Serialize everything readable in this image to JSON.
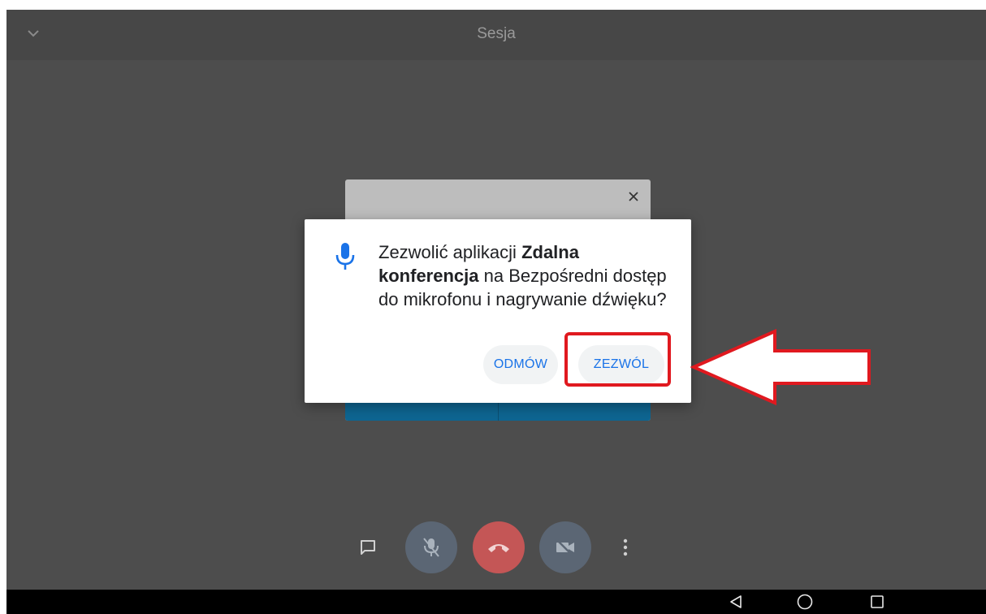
{
  "top_bar": {
    "title": "Sesja",
    "collapse_icon": "chevron-down-icon"
  },
  "background_dialog": {
    "close_icon": "close-icon"
  },
  "permission_dialog": {
    "icon": "microphone-icon",
    "text_before": "Zezwolić aplikacji ",
    "app_name": "Zdalna konferencja",
    "text_after": " na Bezpośredni dostęp do mikrofonu i nagrywanie dźwięku?",
    "deny_label": "ODMÓW",
    "allow_label": "ZEZWÓL"
  },
  "controls": {
    "chat_icon": "chat-icon",
    "mic_icon": "microphone-off-icon",
    "hangup_icon": "hang-up-icon",
    "camera_icon": "camera-off-icon",
    "more_icon": "more-vertical-icon"
  },
  "nav_bar": {
    "back_icon": "back-icon",
    "home_icon": "home-icon",
    "recent_icon": "recent-apps-icon"
  },
  "colors": {
    "accent": "#1a73e8",
    "highlight": "#e0191f",
    "hangup": "#c45656",
    "background": "#4d4d4d"
  }
}
